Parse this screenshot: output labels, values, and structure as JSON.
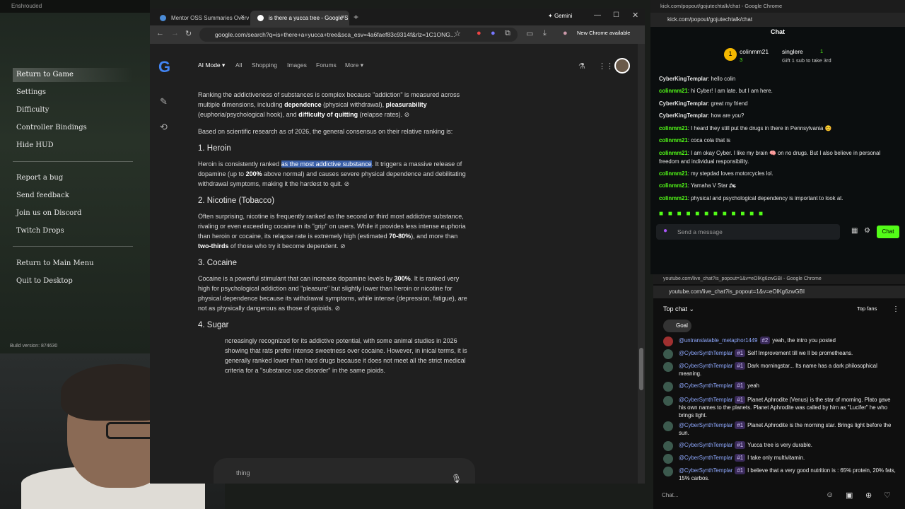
{
  "game": {
    "title": "Enshrouded",
    "menu": [
      "Return to Game",
      "Settings",
      "Difficulty",
      "Controller Bindings",
      "Hide HUD",
      "Report a bug",
      "Send feedback",
      "Join us on Discord",
      "Twitch Drops",
      "Return to Main Menu",
      "Quit to Desktop"
    ],
    "build": "Build version: 874630"
  },
  "chrome": {
    "tabs": [
      "Mentor OSS Summaries Overvi",
      "is there a yucca tree - Google S"
    ],
    "gemini": "Gemini",
    "url": "google.com/search?q=is+there+a+yucca+tree&sca_esv=4a6faef83c9314f&rlz=1C1ONG...",
    "update": "New Chrome available",
    "nav": {
      "ai_mode": "AI Mode",
      "all": "All",
      "shopping": "Shopping",
      "images": "Images",
      "forums": "Forums",
      "more": "More"
    },
    "content": {
      "intro": "Ranking the addictiveness of substances is complex because \"addiction\" is measured across multiple dimensions, including",
      "dependence": "dependence",
      "intro2": "(physical withdrawal),",
      "pleasurability": "pleasurability",
      "intro3": "(euphoria/psychological hook), and",
      "difficulty": "difficulty of quitting",
      "intro4": "(relapse rates).",
      "based": "Based on scientific research as of 2026, the general consensus on their relative ranking is:",
      "h1": "1. Heroin",
      "heroin_a": "Heroin is consistently ranked",
      "heroin_hl": "as the most addictive substance",
      "heroin_b": ". It triggers a massive release of dopamine (up to",
      "heroin_pct": "200%",
      "heroin_c": "above normal) and causes severe physical dependence and debilitating withdrawal symptoms, making it the hardest to quit.",
      "h2": "2. Nicotine (Tobacco)",
      "nic_a": "Often surprising, nicotine is frequently ranked as the second or third most addictive substance, rivaling or even exceeding cocaine in its \"grip\" on users. While it provides less intense euphoria than heroin or cocaine, its relapse rate is extremely high (estimated",
      "nic_pct": "70-80%",
      "nic_b": "), and more than",
      "nic_frac": "two-thirds",
      "nic_c": "of those who try it become dependent.",
      "h3": "3. Cocaine",
      "coc_a": "Cocaine is a powerful stimulant that can increase dopamine levels by",
      "coc_pct": "300%",
      "coc_b": ". It is ranked very high for psychological addiction and \"pleasure\" but slightly lower than heroin or nicotine for physical dependence because its withdrawal symptoms, while intense (depression, fatigue), are not as physically dangerous as those of opioids.",
      "h4": "4. Sugar",
      "sugar": "ncreasingly recognized for its addictive potential, with some animal studies in 2026 showing that rats prefer intense sweetness over cocaine. However, in inical terms, it is generally ranked lower than hard drugs because it does not meet all the strict medical criteria for a \"substance use disorder\" in the same pioids.",
      "ask": "thing"
    }
  },
  "kick": {
    "window_title": "kick.com/popout/gojutechtalk/chat - Google Chrome",
    "url": "kick.com/popout/gojutechtalk/chat",
    "title": "Chat",
    "top1": "colinmm21",
    "top1_count": "3",
    "top2": "singlere",
    "top2_count": "1",
    "gift": "Gift 1 sub to take 3rd",
    "messages": [
      {
        "user": "CyberKingTemplar",
        "text": "hello colin",
        "type": "u1"
      },
      {
        "user": "colinmm21",
        "text": "hi Cyber! I am late. but I am here.",
        "type": "u2"
      },
      {
        "user": "CyberKingTemplar",
        "text": "great my friend",
        "type": "u1"
      },
      {
        "user": "CyberKingTemplar",
        "text": "how are you?",
        "type": "u1"
      },
      {
        "user": "colinmm21",
        "text": "I heard they still put the drugs in there in Pennsylvania 😊",
        "type": "u2"
      },
      {
        "user": "colinmm21",
        "text": "coca cola that is",
        "type": "u2"
      },
      {
        "user": "colinmm21",
        "text": "I am okay Cyber. I like my brain 🧠 on no drugs. But I also believe in personal freedom and individual responsibility.",
        "type": "u2"
      },
      {
        "user": "colinmm21",
        "text": "my stepdad loves motorcycles lol.",
        "type": "u2"
      },
      {
        "user": "colinmm21",
        "text": "Yamaha V Star 🏍",
        "type": "u2"
      },
      {
        "user": "colinmm21",
        "text": "physical and psychological dependency is important to look at.",
        "type": "u2"
      }
    ],
    "input_placeholder": "Send a message",
    "chat_button": "Chat"
  },
  "youtube": {
    "window_title": "youtube.com/live_chat?is_popout=1&v=eOlKg6zwGBI - Google Chrome",
    "url": "youtube.com/live_chat?is_popout=1&v=eOlKg6zwGBI",
    "top_chat": "Top chat",
    "top_fans": "Top fans",
    "goal": "Goal",
    "messages": [
      {
        "user": "@untranslatable_metaphor1449",
        "badge": "#2",
        "text": "yeah, the intro you posted"
      },
      {
        "user": "@CyberSynthTemplar",
        "badge": "#1",
        "text": "Self Improvement till we ll be prometheans."
      },
      {
        "user": "@CyberSynthTemplar",
        "badge": "#1",
        "text": "Dark morningstar... Its name has a dark philosophical meaning."
      },
      {
        "user": "@CyberSynthTemplar",
        "badge": "#1",
        "text": "yeah"
      },
      {
        "user": "@CyberSynthTemplar",
        "badge": "#1",
        "text": "Planet Aphrodite (Venus) is the star of morning. Plato gave his own names to the planets. Planet Aphrodite was called by him as \"Lucifer\" he who brings light."
      },
      {
        "user": "@CyberSynthTemplar",
        "badge": "#1",
        "text": "Planet Aphrodite is the morning star. Brings light before the sun."
      },
      {
        "user": "@CyberSynthTemplar",
        "badge": "#1",
        "text": "Yucca tree is very durable."
      },
      {
        "user": "@CyberSynthTemplar",
        "badge": "#1",
        "text": "I take only multivitamin."
      },
      {
        "user": "@CyberSynthTemplar",
        "badge": "#1",
        "text": "I believe that a very good nutrition is : 65% protein, 20% fats, 15% carbos."
      }
    ],
    "input_placeholder": "Chat..."
  }
}
